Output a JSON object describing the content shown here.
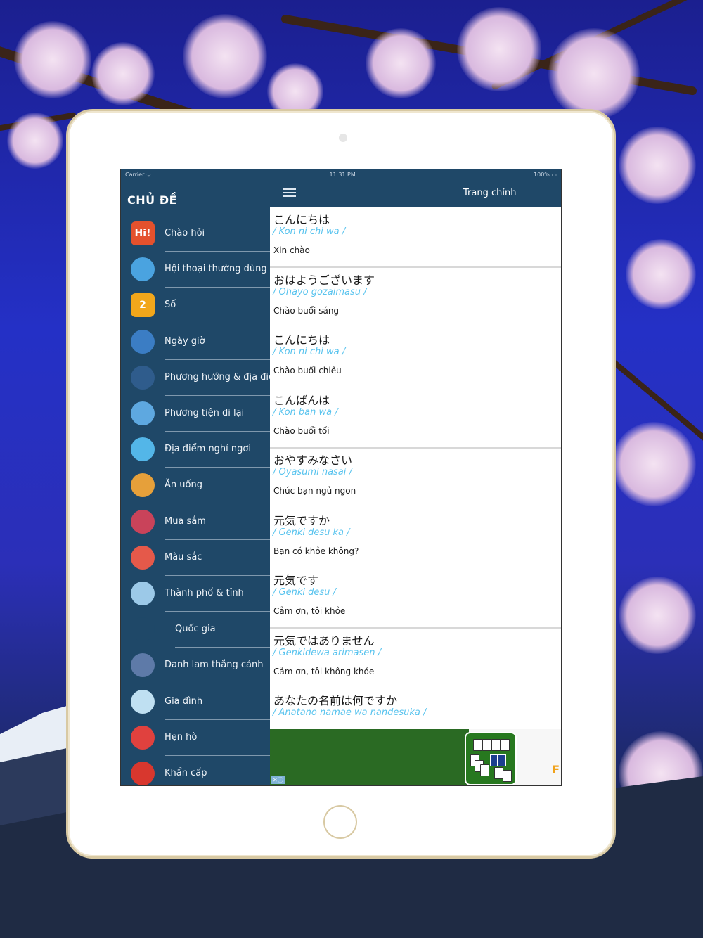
{
  "status_bar": {
    "carrier": "Carrier ᯤ",
    "time": "11:31 PM",
    "battery": "100% ▭"
  },
  "sidebar": {
    "title": "CHỦ ĐỀ",
    "items": [
      {
        "label": "Chào hỏi",
        "icon": "hi-icon",
        "icon_text": "Hi!",
        "color": "#e4512d"
      },
      {
        "label": "Hội thoại thường dùng",
        "icon": "speech-bubble-icon",
        "icon_text": "",
        "color": "#4aa3e0"
      },
      {
        "label": "Số",
        "icon": "number-two-icon",
        "icon_text": "2",
        "color": "#f2a71b"
      },
      {
        "label": "Ngày giờ",
        "icon": "calendar-clock-icon",
        "icon_text": "",
        "color": "#3b7dc4"
      },
      {
        "label": "Phương hướng & địa điểm",
        "icon": "compass-icon",
        "icon_text": "",
        "color": "#2f5c8c"
      },
      {
        "label": "Phương tiện di lại",
        "icon": "transport-icon",
        "icon_text": "",
        "color": "#5ea8e0"
      },
      {
        "label": "Địa điểm nghỉ ngơi",
        "icon": "beach-icon",
        "icon_text": "",
        "color": "#53b6e8"
      },
      {
        "label": "Ăn uống",
        "icon": "food-icon",
        "icon_text": "",
        "color": "#e6a03a"
      },
      {
        "label": "Mua sắm",
        "icon": "shopping-icon",
        "icon_text": "",
        "color": "#c9435a"
      },
      {
        "label": "Màu sắc",
        "icon": "color-wheel-icon",
        "icon_text": "",
        "color": "#e5594a"
      },
      {
        "label": "Thành phố & tỉnh",
        "icon": "city-icon",
        "icon_text": "",
        "color": "#9cc9e8"
      },
      {
        "label": "Quốc gia",
        "icon": "country-pins-icon",
        "icon_text": "",
        "color": "#1f4868"
      },
      {
        "label": "Danh lam thắng cảnh",
        "icon": "landmark-icon",
        "icon_text": "",
        "color": "#5e7aa8"
      },
      {
        "label": "Gia đình",
        "icon": "family-icon",
        "icon_text": "",
        "color": "#bfe0f2"
      },
      {
        "label": "Hẹn hò",
        "icon": "heart-icon",
        "icon_text": "",
        "color": "#e0413e"
      },
      {
        "label": "Khẩn cấp",
        "icon": "emergency-icon",
        "icon_text": "",
        "color": "#d8372e"
      }
    ]
  },
  "navbar": {
    "title": "Trang chính",
    "menu_icon": "hamburger-icon"
  },
  "phrases": [
    {
      "jp": "こんにちは",
      "romaji": "/ Kon ni chi wa /",
      "vi": "Xin chào",
      "separator": true
    },
    {
      "jp": "おはようございます",
      "romaji": "/ Ohayo gozaimasu /",
      "vi": "Chào buổi sáng",
      "separator": false
    },
    {
      "jp": "こんにちは",
      "romaji": "/ Kon ni chi wa /",
      "vi": "Chào buổi chiều",
      "separator": false
    },
    {
      "jp": "こんばんは",
      "romaji": "/ Kon ban wa /",
      "vi": "Chào buổi tối",
      "separator": true
    },
    {
      "jp": "おやすみなさい",
      "romaji": "/ Oyasumi nasai /",
      "vi": "Chúc bạn ngủ ngon",
      "separator": false
    },
    {
      "jp": "元気ですか",
      "romaji": "/ Genki desu ka /",
      "vi": "Bạn có khỏe không?",
      "separator": false
    },
    {
      "jp": "元気です",
      "romaji": "/ Genki desu /",
      "vi": "Cảm ơn, tôi khỏe",
      "separator": true
    },
    {
      "jp": "元気ではありません",
      "romaji": "/ Genkidewa arimasen /",
      "vi": "Cảm ơn, tôi không khỏe",
      "separator": false
    },
    {
      "jp": "あなたの名前は何ですか",
      "romaji": "/ Anatano namae wa nandesuka /",
      "vi": "",
      "separator": false
    }
  ],
  "ad": {
    "letter": "F",
    "close": "✕ⓘ"
  }
}
